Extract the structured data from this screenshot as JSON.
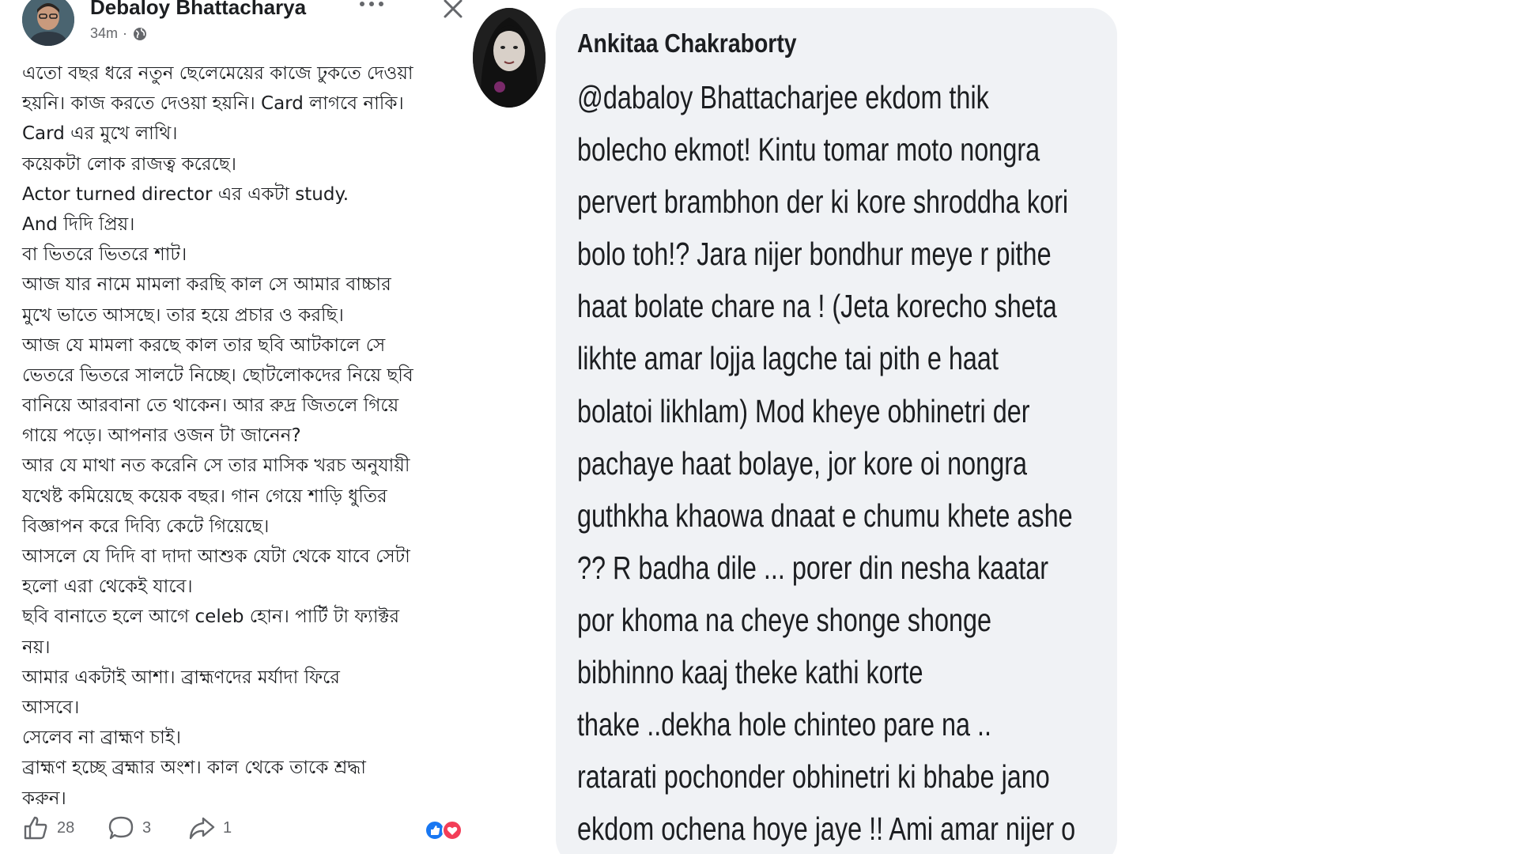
{
  "post": {
    "author": "Debaloy Bhattacharya",
    "time": "34m",
    "dot": "·",
    "icons": {
      "avatar": "avatar-photo",
      "privacy": "globe-icon",
      "more": "more-options-icon",
      "close": "close-icon"
    },
    "body_lines": [
      "এতো বছর ধরে নতুন ছেলেমেয়ের কাজে ঢুকতে দেওয়া",
      "হয়নি। কাজ করতে দেওয়া হয়নি। Card লাগবে নাকি।",
      "Card এর মুখে লাথি।",
      "কয়েকটা লোক রাজত্ব করেছে।",
      "Actor turned director এর একটা study.",
      "And দিদি প্রিয়।",
      "বা ভিতরে ভিতরে শাট।",
      "আজ যার নামে মামলা করছি কাল সে আমার বাচ্চার",
      "মুখে ভাতে আসছে। তার হয়ে প্রচার ও করছি।",
      "আজ যে মামলা করছে কাল তার ছবি আটকালে সে",
      "ভেতরে ভিতরে সালটে নিচ্ছে। ছোটলোকদের নিয়ে ছবি",
      "বানিয়ে আরবানা তে থাকেন। আর রুদ্র জিতলে গিয়ে",
      "গায়ে পড়ে। আপনার ওজন টা জানেন?",
      "আর যে মাথা নত করেনি সে তার মাসিক খরচ অনুযায়ী",
      "যথেষ্ট কমিয়েছে কয়েক বছর। গান গেয়ে শাড়ি ধুতির",
      "বিজ্ঞাপন করে দিব্যি কেটে গিয়েছে।",
      "আসলে যে দিদি বা দাদা আশুক যেটা থেকে যাবে সেটা",
      "হলো এরা থেকেই যাবে।",
      "ছবি বানাতে হলে আগে celeb হোন। পার্টি টা ফ্যাক্টর",
      "নয়।",
      "আমার একটাই আশা। ব্রাহ্মণদের মর্যাদা ফিরে",
      "আসবে।",
      "সেলেব না ব্রাহ্মণ চাই।",
      "ব্রাহ্মণ হচ্ছে ব্রহ্মার অংশ। কাল থেকে তাকে শ্রদ্ধা",
      "করুন।"
    ],
    "actions": {
      "likes": "28",
      "comments": "3",
      "shares": "1",
      "like_icon": "thumbs-up-icon",
      "comment_icon": "comment-bubble-icon",
      "share_icon": "share-arrow-icon",
      "reaction_icons": [
        "like-reaction-icon",
        "love-reaction-icon"
      ]
    }
  },
  "comment": {
    "author": "Ankitaa Chakraborty",
    "avatar_icon": "commenter-avatar-photo",
    "body_lines": [
      "@dabaloy Bhattacharjee ekdom thik",
      "bolecho ekmot! Kintu tomar moto nongra",
      "pervert brambhon der ki kore shroddha kori",
      "bolo toh!? Jara  nijer bondhur meye r pithe",
      "haat bolate chare na ! (Jeta korecho sheta",
      "likhte amar lojja lagche tai pith e haat",
      "bolatoi likhlam) Mod kheye obhinetri der",
      "pachaye haat bolaye, jor kore oi nongra",
      "guthkha khaowa dnaat e chumu khete ashe",
      "?? R badha dile ... porer din nesha kaatar",
      "por khoma na cheye shonge shonge",
      "bibhinno kaaj theke kathi korte",
      "thake ..dekha hole chinteo pare na ..",
      "ratarati pochonder obhinetri ki bhabe jano",
      "ekdom ochena hoye jaye !! Ami amar nijer o"
    ]
  },
  "colors": {
    "text": "#1c1e21",
    "muted": "#65676b",
    "bubble": "#f0f2f5",
    "like_blue": "#1877f2",
    "love_red": "#f33e58"
  }
}
